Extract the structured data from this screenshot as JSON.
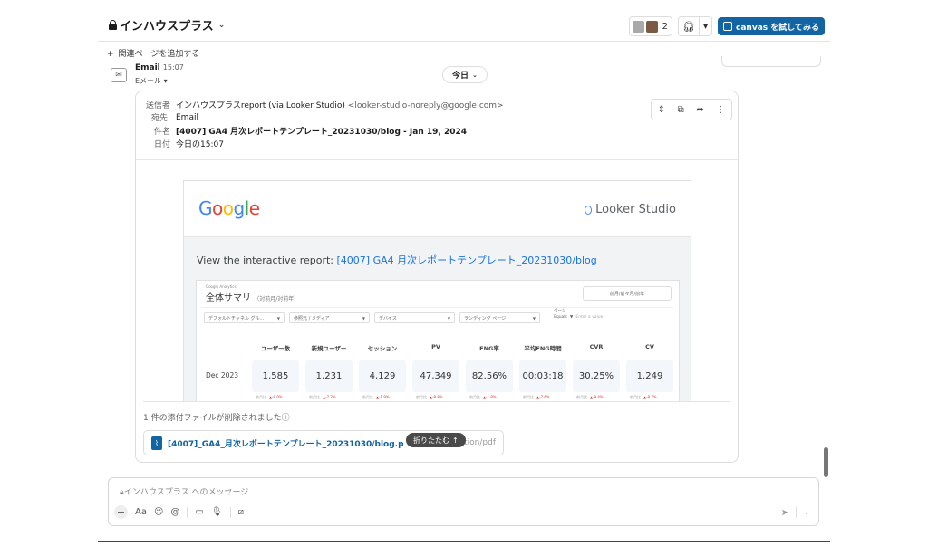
{
  "header": {
    "channel_name": "インハウスプラス",
    "member_count": "2",
    "canvas_button": "canvas を試してみる"
  },
  "subbar": {
    "add_page": "関連ページを追加する"
  },
  "message": {
    "sender": "Email",
    "time": "15:07",
    "sub": "Eメール",
    "date_divider": "今日"
  },
  "email": {
    "from_label": "送信者",
    "from_name": "インハウスプラスreport (via Looker Studio)",
    "from_addr": "<looker-studio-noreply@google.com>",
    "to_label": "宛先:",
    "to_value": "Email",
    "subject_label": "件名",
    "subject_value": "[4007] GA4 月次レポートテンプレート_20231030/blog - Jan 19, 2024",
    "date_label": "日付",
    "date_value": "今日の15:07"
  },
  "looker": {
    "google_logo": "Google",
    "brand": "Looker Studio",
    "view_prefix": "View the interactive report: ",
    "report_link": "[4007] GA4 月次レポートテンプレート_20231030/blog"
  },
  "report": {
    "source": "Google Analytics",
    "title": "全体サマリ",
    "title_note": "（対前月/対前年）",
    "date_box": "前月/前々月/前年",
    "filters": [
      "デフォルトチャネル グル...",
      "参照元 / メディア",
      "デバイス",
      "ランディング ページ"
    ],
    "page_filter_label": "ページ",
    "page_filter_op": "Equals",
    "page_filter_ph": "Enter a value",
    "row_label": "Dec 2023",
    "delta_label": "前月比",
    "metrics": [
      {
        "name": "ユーザー数",
        "value": "1,585",
        "delta": "-9.0%"
      },
      {
        "name": "新規ユーザー",
        "value": "1,231",
        "delta": "-7.7%"
      },
      {
        "name": "セッション",
        "value": "4,129",
        "delta": "-1.9%"
      },
      {
        "name": "PV",
        "value": "47,349",
        "delta": "-8.8%"
      },
      {
        "name": "ENG率",
        "value": "82.56%",
        "delta": "-1.8%"
      },
      {
        "name": "平均ENG時間",
        "value": "00:03:18",
        "delta": "-7.6%"
      },
      {
        "name": "CVR",
        "value": "30.25%",
        "delta": "-9.4%"
      },
      {
        "name": "CV",
        "value": "1,249",
        "delta": "-8.7%"
      }
    ]
  },
  "attachment": {
    "removed_text": "1 件の添付ファイルが削除されました",
    "file_name": "[4007]_GA4_月次レポートテンプレート_20231030/blog.p",
    "file_mime": "tion/pdf",
    "collapse_label": "折りたたむ"
  },
  "composer": {
    "placeholder": "インハウスプラス へのメッセージ"
  }
}
